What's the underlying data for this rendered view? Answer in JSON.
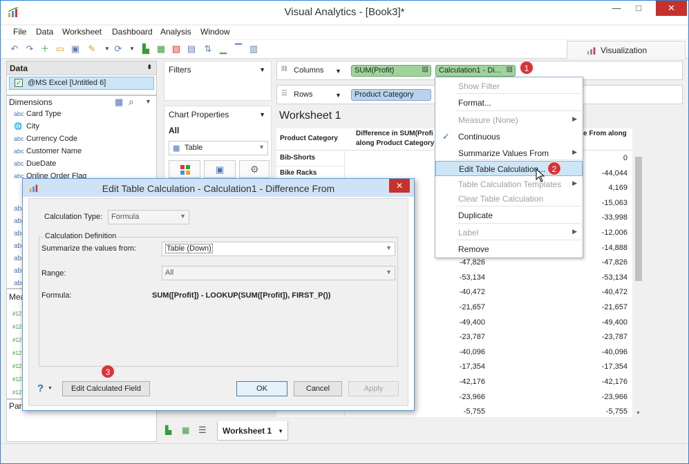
{
  "window": {
    "title": "Visual Analytics - [Book3]*",
    "minimize": "—",
    "maximize": "□",
    "close": "✕"
  },
  "menu": [
    "File",
    "Data",
    "Worksheet",
    "Dashboard",
    "Analysis",
    "Window"
  ],
  "visualization_tab": "Visualization",
  "data_pane": {
    "header": "Data",
    "source": "@MS Excel [Untitled 6]",
    "dimensions_header": "Dimensions",
    "dimensions": [
      {
        "type": "abc",
        "name": "Card Type"
      },
      {
        "type": "globe",
        "name": "City"
      },
      {
        "type": "abc",
        "name": "Currency Code"
      },
      {
        "type": "abc",
        "name": "Customer Name"
      },
      {
        "type": "abc",
        "name": "DueDate"
      },
      {
        "type": "abc",
        "name": "Online Order Flag"
      }
    ],
    "measures_header": "Mea",
    "parameters_header": "Para"
  },
  "filters_label": "Filters",
  "chart_properties": {
    "label": "Chart Properties",
    "all": "All",
    "chart_type": "Table"
  },
  "columns_label": "Columns",
  "rows_label": "Rows",
  "columns_pills": [
    "SUM(Profit)",
    "Calculation1 - Di..."
  ],
  "rows_pills": [
    "Product Category"
  ],
  "worksheet_title": "Worksheet 1",
  "table": {
    "col1": "Product Category",
    "col2a": "Difference in SUM(Profi",
    "col2b": "along Product Category",
    "col3": "e From along",
    "rows": [
      {
        "cat": "Bib-Shorts",
        "v1": "",
        "v2": "0"
      },
      {
        "cat": "Bike Racks",
        "v1": "",
        "v2": "-44,044"
      },
      {
        "cat": "",
        "v1": "",
        "v2": "4,169"
      },
      {
        "cat": "",
        "v1": "",
        "v2": "-15,063"
      },
      {
        "cat": "",
        "v1": "",
        "v2": "-33,998"
      },
      {
        "cat": "",
        "v1": "",
        "v2": "-12,006"
      },
      {
        "cat": "",
        "v1": "",
        "v2": "-14,888"
      },
      {
        "cat": "",
        "v1": "-47,826",
        "v2": "-47,826"
      },
      {
        "cat": "",
        "v1": "-53,134",
        "v2": "-53,134"
      },
      {
        "cat": "",
        "v1": "-40,472",
        "v2": "-40,472"
      },
      {
        "cat": "",
        "v1": "-21,657",
        "v2": "-21,657"
      },
      {
        "cat": "",
        "v1": "-49,400",
        "v2": "-49,400"
      },
      {
        "cat": "",
        "v1": "-23,787",
        "v2": "-23,787"
      },
      {
        "cat": "",
        "v1": "-40,096",
        "v2": "-40,096"
      },
      {
        "cat": "",
        "v1": "-17,354",
        "v2": "-17,354"
      },
      {
        "cat": "",
        "v1": "-42,176",
        "v2": "-42,176"
      },
      {
        "cat": "",
        "v1": "-23,966",
        "v2": "-23,966"
      },
      {
        "cat": "",
        "v1": "-5,755",
        "v2": "-5,755"
      }
    ]
  },
  "context_menu": [
    {
      "label": "Show Filter",
      "disabled": true,
      "arrow": false
    },
    {
      "label": "Format...",
      "disabled": false,
      "arrow": false
    },
    {
      "label": "Measure (None)",
      "disabled": true,
      "arrow": true
    },
    {
      "label": "Continuous",
      "disabled": false,
      "arrow": false,
      "checked": true
    },
    {
      "label": "Summarize Values From",
      "disabled": false,
      "arrow": true
    },
    {
      "label": "Edit Table Calculation...",
      "disabled": false,
      "arrow": false,
      "selected": true
    },
    {
      "label": "Table Calculation Templates",
      "disabled": true,
      "arrow": true
    },
    {
      "label": "Clear Table Calculation",
      "disabled": true,
      "arrow": false
    },
    {
      "label": "Duplicate",
      "disabled": false,
      "arrow": false
    },
    {
      "label": "Label",
      "disabled": true,
      "arrow": true
    },
    {
      "label": "Remove",
      "disabled": false,
      "arrow": false
    }
  ],
  "badges": [
    "1",
    "2",
    "3"
  ],
  "dialog": {
    "title": "Edit Table Calculation - Calculation1 - Difference From",
    "calc_type_label": "Calculation Type:",
    "calc_type_value": "Formula",
    "calc_def_label": "Calculation Definition",
    "summarize_label": "Summarize the values from:",
    "summarize_value": "Table (Down)",
    "range_label": "Range:",
    "range_value": "All",
    "formula_label": "Formula:",
    "formula_value": "SUM([Profit]) - LOOKUP(SUM([Profit]), FIRST_P())",
    "help": "?",
    "edit_calc_button": "Edit Calculated Field",
    "ok_button": "OK",
    "cancel_button": "Cancel",
    "apply_button": "Apply"
  },
  "sheet_tab": "Worksheet 1",
  "colors": {
    "accent": "#2a82da",
    "badge": "#d9333a",
    "pill_green": "#9ed49a",
    "pill_blue": "#b8d3ef"
  }
}
